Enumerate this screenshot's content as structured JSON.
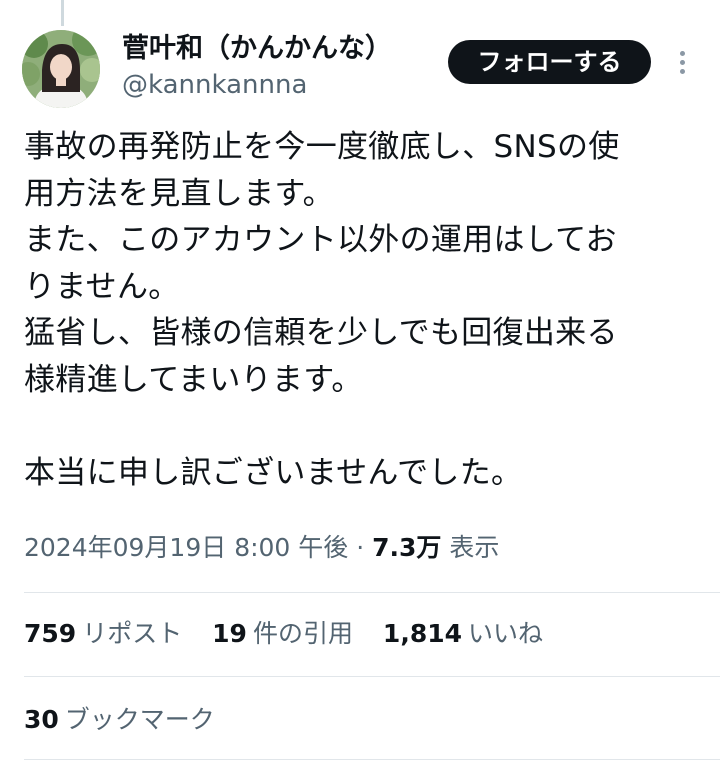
{
  "author": {
    "display_name": "菅叶和（かんかんな）",
    "handle": "@kannkannna"
  },
  "follow_label": "フォローする",
  "tweet": {
    "text": "事故の再発防止を今一度徹底し、SNSの使\n用方法を見直します。\nまた、このアカウント以外の運用はしてお\nりません。\n猛省し、皆様の信頼を少しでも回復出来る\n様精進してまいります。\n\n本当に申し訳ございませんでした。",
    "timestamp": "2024年09月19日 8:00 午後",
    "separator": "·",
    "views_count": "7.3万",
    "views_label": "表示"
  },
  "stats": {
    "reposts": {
      "count": "759",
      "label": "リポスト"
    },
    "quotes": {
      "count": "19",
      "label": "件の引用"
    },
    "likes": {
      "count": "1,814",
      "label": "いいね"
    },
    "bookmarks": {
      "count": "30",
      "label": "ブックマーク"
    }
  },
  "colors": {
    "text_primary": "#0f1419",
    "text_secondary": "#536471",
    "follow_button_bg": "#0f1419",
    "divider": "#e1e6ea"
  },
  "icons": {
    "more": "more-vertical-icon",
    "avatar": "profile-photo"
  }
}
